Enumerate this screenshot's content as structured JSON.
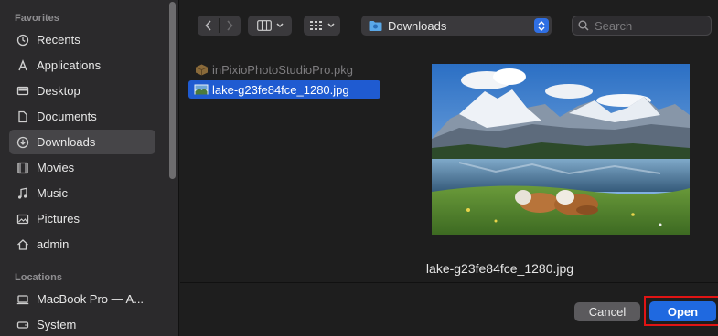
{
  "sidebar": {
    "favorites_heading": "Favorites",
    "locations_heading": "Locations",
    "items": [
      {
        "label": "Recents",
        "icon": "clock-icon"
      },
      {
        "label": "Applications",
        "icon": "applications-icon"
      },
      {
        "label": "Desktop",
        "icon": "desktop-icon"
      },
      {
        "label": "Documents",
        "icon": "document-icon"
      },
      {
        "label": "Downloads",
        "icon": "download-icon",
        "selected": true
      },
      {
        "label": "Movies",
        "icon": "film-icon"
      },
      {
        "label": "Music",
        "icon": "music-note-icon"
      },
      {
        "label": "Pictures",
        "icon": "photo-icon"
      },
      {
        "label": "admin",
        "icon": "home-icon"
      }
    ],
    "locations": [
      {
        "label": "MacBook Pro — A...",
        "icon": "laptop-icon"
      },
      {
        "label": "System",
        "icon": "disk-icon"
      }
    ]
  },
  "toolbar": {
    "path_label": "Downloads",
    "search_placeholder": "Search"
  },
  "files": [
    {
      "name": "inPixioPhotoStudioPro.pkg",
      "icon": "package-icon",
      "state": "dim"
    },
    {
      "name": "lake-g23fe84fce_1280.jpg",
      "icon": "image-file-icon",
      "state": "selected"
    }
  ],
  "preview": {
    "filename": "lake-g23fe84fce_1280.jpg"
  },
  "buttons": {
    "cancel": "Cancel",
    "open": "Open"
  },
  "colors": {
    "accent": "#1f69e0",
    "selection": "#1f5bd1",
    "highlight_frame": "#e01414"
  }
}
